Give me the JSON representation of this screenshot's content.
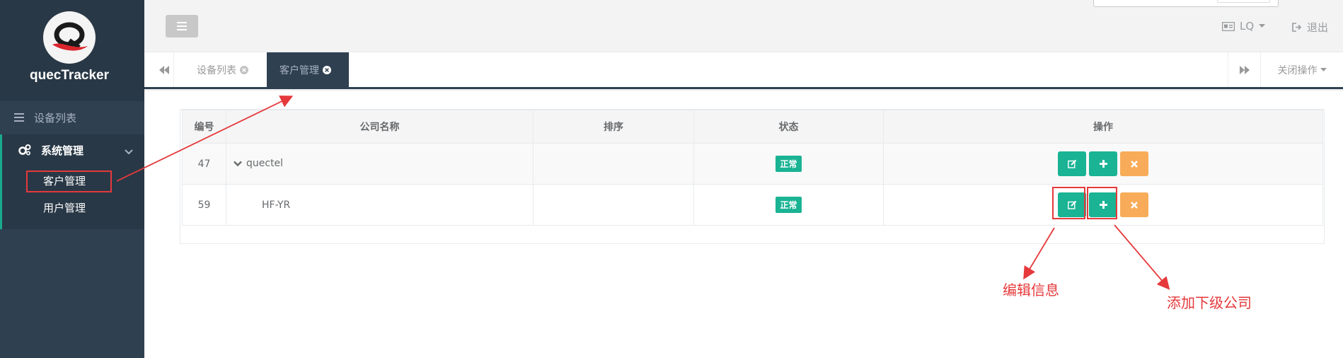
{
  "sidebar": {
    "app_name": "quecTracker",
    "nav_devices": "设备列表",
    "nav_system": "系统管理",
    "sub_customers": "客户管理",
    "sub_users": "用户管理"
  },
  "topbar": {
    "user": "LQ",
    "logout": "退出"
  },
  "tabs": {
    "devices": "设备列表",
    "customers": "客户管理",
    "close_ops": "关闭操作"
  },
  "table": {
    "headers": [
      "编号",
      "公司名称",
      "排序",
      "状态",
      "操作"
    ],
    "rows": [
      {
        "id": "47",
        "name": "quectel",
        "sort": "",
        "status": "正常"
      },
      {
        "id": "59",
        "name": "HF-YR",
        "sort": "",
        "status": "正常"
      }
    ]
  },
  "annotations": {
    "edit": "编辑信息",
    "add": "添加下级公司"
  },
  "colors": {
    "sidebar": "#2f4050",
    "primary": "#1ab394",
    "warning": "#f8ac59",
    "annotation": "#e5393b"
  }
}
